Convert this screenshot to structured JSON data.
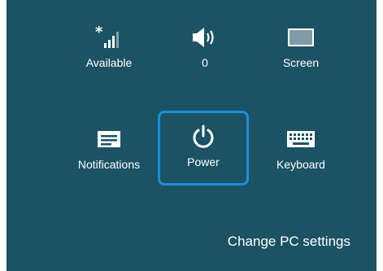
{
  "settings": {
    "tiles": [
      {
        "label": "Available",
        "icon": "network-signal-icon"
      },
      {
        "label": "0",
        "icon": "volume-icon"
      },
      {
        "label": "Screen",
        "icon": "screen-brightness-icon"
      },
      {
        "label": "Notifications",
        "icon": "notifications-icon"
      },
      {
        "label": "Power",
        "icon": "power-icon",
        "selected": true
      },
      {
        "label": "Keyboard",
        "icon": "keyboard-icon"
      }
    ],
    "change_pc_settings": "Change PC settings"
  },
  "colors": {
    "background": "#1b5364",
    "selection_border": "#1c8fd8",
    "text": "#ffffff"
  }
}
